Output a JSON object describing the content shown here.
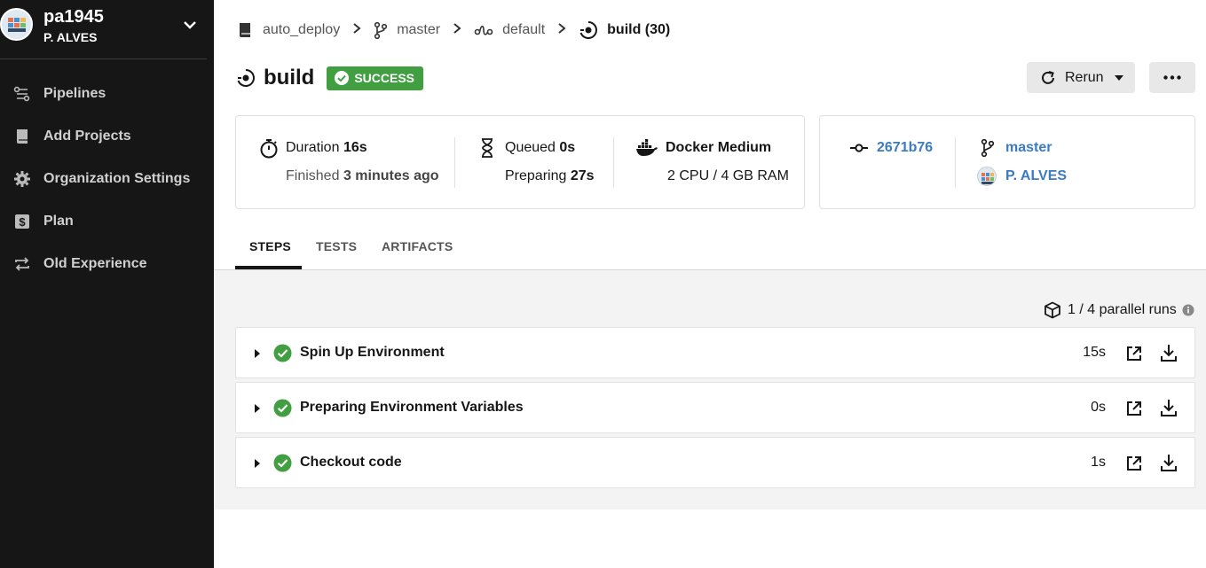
{
  "sidebar": {
    "org_name": "pa1945",
    "org_user": "P. ALVES",
    "items": [
      {
        "label": "Pipelines",
        "icon": "pipelines-icon"
      },
      {
        "label": "Add Projects",
        "icon": "book-icon"
      },
      {
        "label": "Organization Settings",
        "icon": "gear-icon"
      },
      {
        "label": "Plan",
        "icon": "dollar-icon"
      },
      {
        "label": "Old Experience",
        "icon": "swap-icon"
      }
    ]
  },
  "breadcrumb": {
    "project": "auto_deploy",
    "branch": "master",
    "workflow": "default",
    "job": "build (30)"
  },
  "header": {
    "title": "build",
    "status": "SUCCESS",
    "rerun_label": "Rerun",
    "more_label": "•••"
  },
  "summary": {
    "duration_label": "Duration",
    "duration_value": "16s",
    "finished_label": "Finished",
    "finished_value": "3 minutes ago",
    "queued_label": "Queued",
    "queued_value": "0s",
    "preparing_label": "Preparing",
    "preparing_value": "27s",
    "executor": "Docker Medium",
    "resources": "2 CPU / 4 GB RAM"
  },
  "commit": {
    "sha": "2671b76",
    "branch": "master",
    "author": "P. ALVES"
  },
  "tabs": [
    "STEPS",
    "TESTS",
    "ARTIFACTS"
  ],
  "parallel_runs": "1 / 4 parallel runs",
  "steps": [
    {
      "name": "Spin Up Environment",
      "duration": "15s"
    },
    {
      "name": "Preparing Environment Variables",
      "duration": "0s"
    },
    {
      "name": "Checkout code",
      "duration": "1s"
    }
  ],
  "colors": {
    "success": "#419e41",
    "link": "#3b7bc0",
    "sidebar": "#161616"
  }
}
